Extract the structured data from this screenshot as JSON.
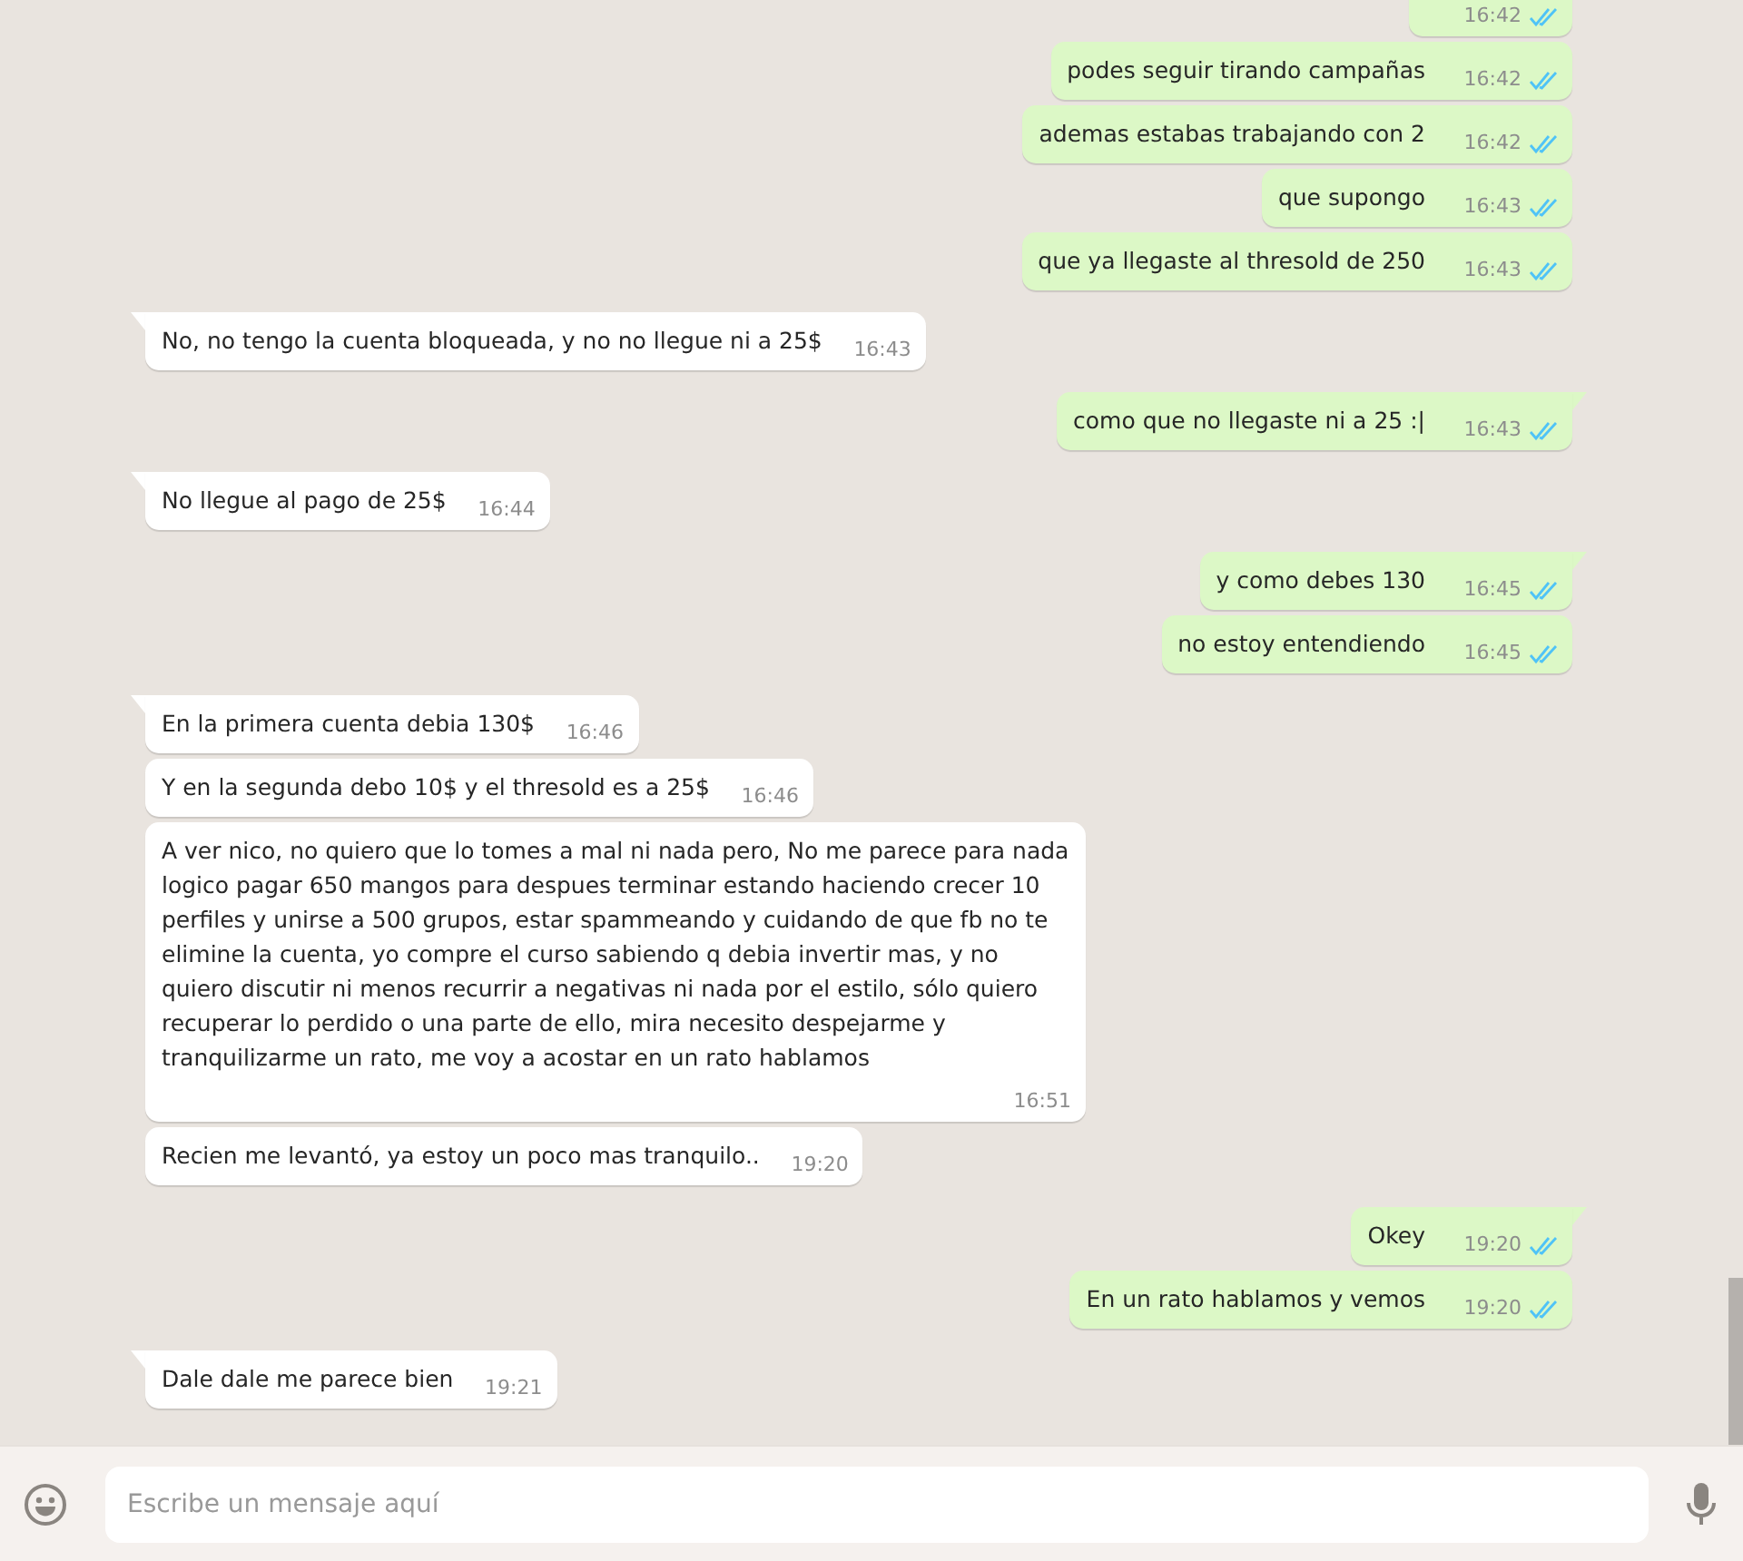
{
  "messages": [
    {
      "outgoing": true,
      "time": "16:42",
      "read": true
    },
    {
      "outgoing": true,
      "text": "podes seguir tirando campañas",
      "time": "16:42",
      "read": true
    },
    {
      "outgoing": true,
      "text": "ademas estabas trabajando con 2",
      "time": "16:42",
      "read": true
    },
    {
      "outgoing": true,
      "text": "que supongo",
      "time": "16:43",
      "read": true
    },
    {
      "outgoing": true,
      "text": "que ya llegaste al thresold de 250",
      "time": "16:43",
      "read": true
    },
    {
      "outgoing": false,
      "text": "No, no tengo la cuenta bloqueada, y no no llegue ni a 25$",
      "time": "16:43"
    },
    {
      "outgoing": true,
      "text": "como que no llegaste ni a 25 :|",
      "time": "16:43",
      "read": true
    },
    {
      "outgoing": false,
      "text": "No llegue al pago de 25$",
      "time": "16:44"
    },
    {
      "outgoing": true,
      "text": "y como debes 130",
      "time": "16:45",
      "read": true
    },
    {
      "outgoing": true,
      "text": "no estoy entendiendo",
      "time": "16:45",
      "read": true
    },
    {
      "outgoing": false,
      "text": "En la primera cuenta debia 130$",
      "time": "16:46"
    },
    {
      "outgoing": false,
      "text": "Y en la segunda debo 10$ y el thresold es a 25$",
      "time": "16:46"
    },
    {
      "outgoing": false,
      "text": "A ver nico, no quiero que lo tomes a mal ni nada pero, No me parece para nada logico pagar 650 mangos para despues terminar estando haciendo crecer 10 perfiles y unirse a 500 grupos, estar spammeando y cuidando de que fb no te elimine la cuenta, yo compre el curso sabiendo q debia invertir mas, y no quiero discutir ni menos recurrir a negativas ni nada por el estilo, sólo quiero recuperar lo perdido o una parte de ello, mira necesito despejarme y tranquilizarme un rato, me voy a acostar en un rato hablamos",
      "time": "16:51"
    },
    {
      "outgoing": false,
      "text": "Recien me levantó, ya estoy un poco mas tranquilo..",
      "time": "19:20"
    },
    {
      "outgoing": true,
      "text": "Okey",
      "time": "19:20",
      "read": true
    },
    {
      "outgoing": true,
      "text": "En un rato hablamos y vemos",
      "time": "19:20",
      "read": true
    },
    {
      "outgoing": false,
      "text": "Dale dale me parece bien",
      "time": "19:21"
    }
  ],
  "composer": {
    "placeholder": "Escribe un mensaje aquí"
  }
}
